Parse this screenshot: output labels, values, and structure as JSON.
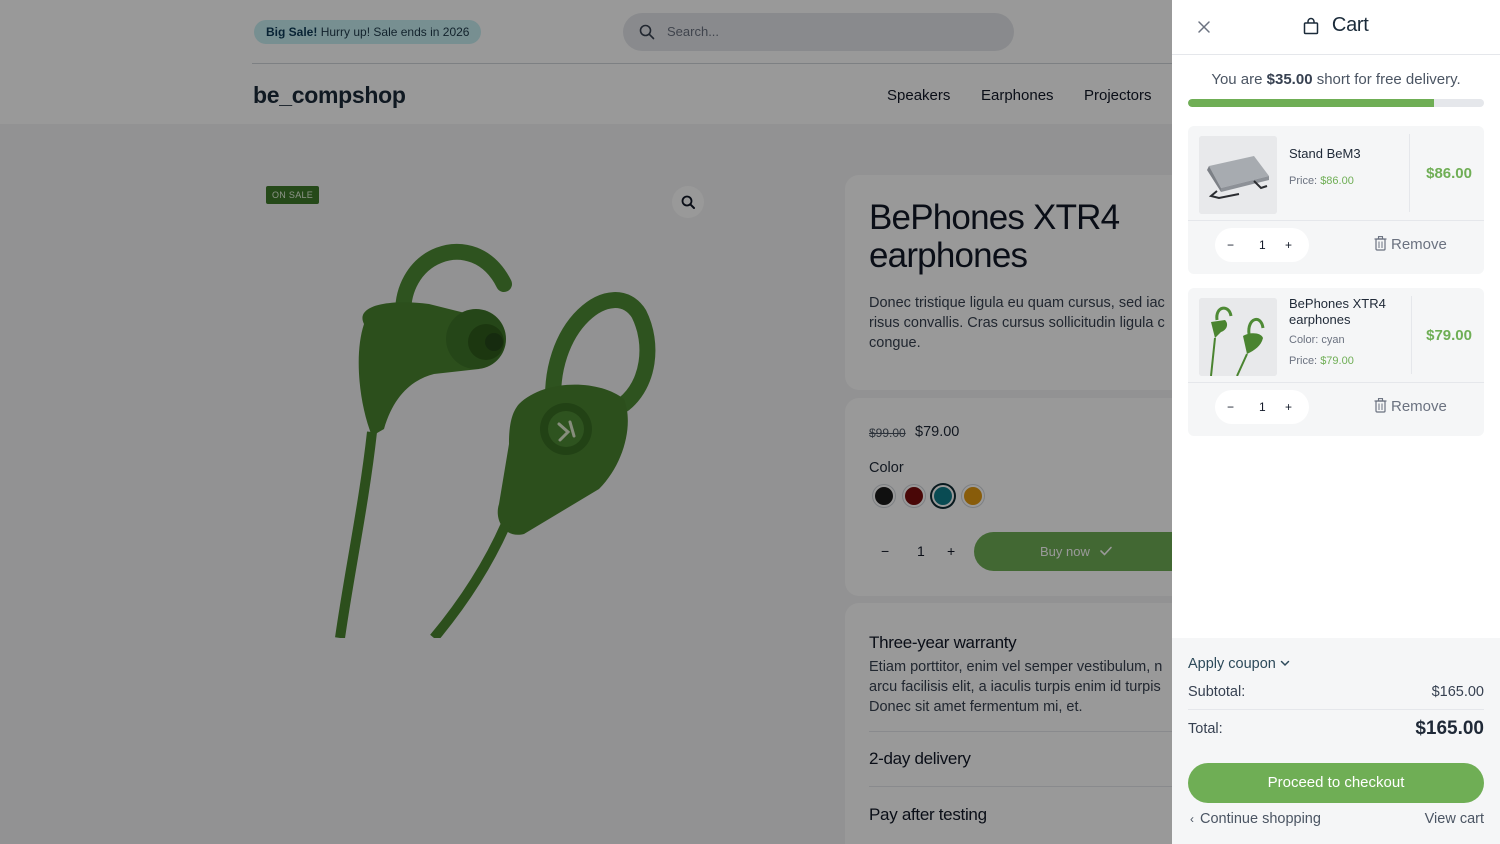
{
  "header": {
    "promo_bold": "Big Sale!",
    "promo_text": "Hurry up! Sale ends in 2026",
    "search_placeholder": "Search...",
    "logo": "be_compshop",
    "nav": [
      "Speakers",
      "Earphones",
      "Projectors"
    ]
  },
  "product": {
    "badge": "ON SALE",
    "title": "BePhones XTR4 earphones",
    "description_lines": [
      "Donec tristique ligula eu quam cursus, sed iac",
      "risus convallis. Cras cursus sollicitudin ligula c",
      "congue."
    ],
    "old_price": "$99.00",
    "price": "$79.00",
    "color_label": "Color",
    "colors": [
      "#1c1c1c",
      "#7a0d0d",
      "#0f7d8a",
      "#e39a11"
    ],
    "selected_color": "cyan",
    "quantity": "1",
    "buy_label": "Buy now",
    "accordion": [
      {
        "title": "Three-year warranty",
        "text_lines": [
          "Etiam porttitor, enim vel semper vestibulum, n",
          "arcu facilisis elit, a iaculis turpis enim id turpis",
          "Donec sit amet fermentum mi, et."
        ]
      },
      {
        "title": "2-day delivery"
      },
      {
        "title": "Pay after testing"
      }
    ]
  },
  "cart": {
    "title": "Cart",
    "free_delivery": {
      "prefix": "You are",
      "amount": "$35.00",
      "suffix": "short for free delivery.",
      "progress_fraction": 0.83
    },
    "items": [
      {
        "name": "Stand BeM3",
        "price_label": "Price:",
        "price": "$86.00",
        "total": "$86.00",
        "quantity": "1",
        "remove_label": "Remove"
      },
      {
        "name": "BePhones XTR4 earphones",
        "color_label": "Color:",
        "color": "cyan",
        "price_label": "Price:",
        "price": "$79.00",
        "total": "$79.00",
        "quantity": "1",
        "remove_label": "Remove"
      }
    ],
    "coupon_label": "Apply coupon",
    "subtotal_label": "Subtotal:",
    "subtotal": "$165.00",
    "total_label": "Total:",
    "total": "$165.00",
    "checkout_label": "Proceed to checkout",
    "continue_label": "Continue shopping",
    "view_cart_label": "View cart"
  },
  "colors": {
    "accent_green": "#6fae55",
    "overlay": "rgba(0,0,0,0.40)",
    "badge_green": "#3f7a2b"
  }
}
